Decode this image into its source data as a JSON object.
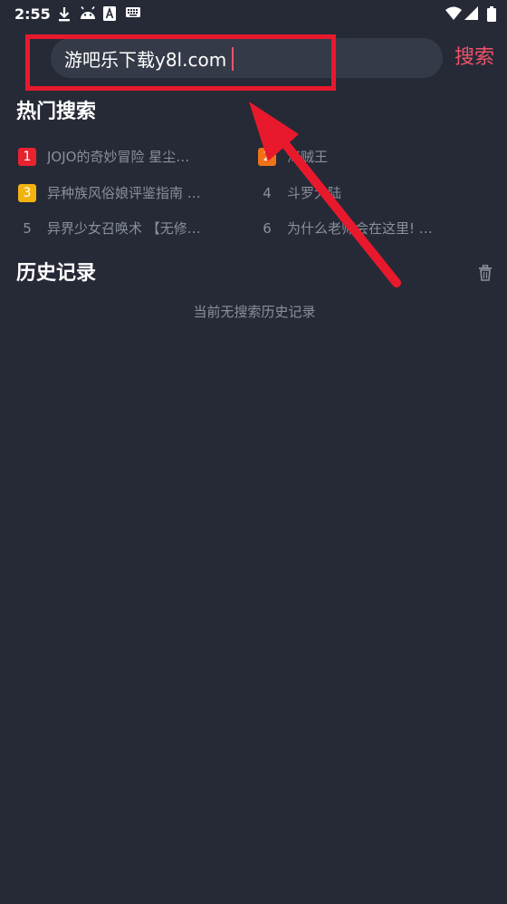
{
  "status_bar": {
    "time": "2:55",
    "left_icons": [
      "download-icon",
      "android-icon",
      "a-badge-icon",
      "keyboard-icon"
    ],
    "right_icons": [
      "wifi-icon",
      "signal-icon",
      "battery-icon"
    ]
  },
  "search": {
    "value": "游吧乐下载y8l.com",
    "button_label": "搜索"
  },
  "hot_search": {
    "title": "热门搜索",
    "items": [
      {
        "rank": "1",
        "text": "JOJO的奇妙冒险 星尘…",
        "badge_color": "#e8232e"
      },
      {
        "rank": "2",
        "text": "海贼王",
        "badge_color": "#f07318"
      },
      {
        "rank": "3",
        "text": "异种族风俗娘评鉴指南 …",
        "badge_color": "#f2b310"
      },
      {
        "rank": "4",
        "text": "斗罗大陆",
        "badge_color": ""
      },
      {
        "rank": "5",
        "text": "异界少女召唤术 【无修…",
        "badge_color": ""
      },
      {
        "rank": "6",
        "text": "为什么老师会在这里! …",
        "badge_color": ""
      }
    ]
  },
  "history": {
    "title": "历史记录",
    "empty_text": "当前无搜索历史记录"
  },
  "colors": {
    "background": "#262a37",
    "search_field": "#353a48",
    "accent": "#f0526a",
    "annotation_red": "#e8192c",
    "muted_text": "#8a8f9c"
  }
}
